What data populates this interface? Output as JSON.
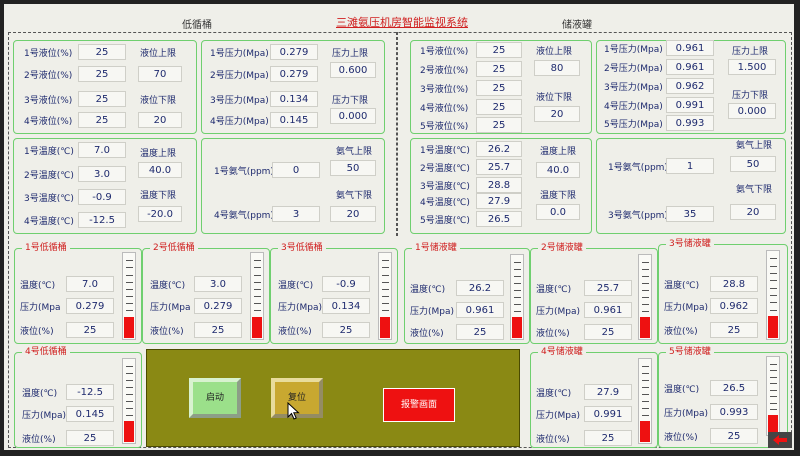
{
  "title": "三滩氨压机房智能监视系统",
  "headers": {
    "left": "低循桶",
    "right": "储液罐"
  },
  "lt_levels": {
    "rows": [
      {
        "label": "1号液位(%)",
        "value": "25"
      },
      {
        "label": "2号液位(%)",
        "value": "25"
      },
      {
        "label": "3号液位(%)",
        "value": "25"
      },
      {
        "label": "4号液位(%)",
        "value": "25"
      }
    ],
    "limits": [
      {
        "label": "液位上限",
        "value": "70"
      },
      {
        "label": "液位下限",
        "value": "20"
      }
    ]
  },
  "lt_press": {
    "rows": [
      {
        "label": "1号压力(Mpa)",
        "value": "0.279"
      },
      {
        "label": "2号压力(Mpa)",
        "value": "0.279"
      },
      {
        "label": "3号压力(Mpa)",
        "value": "0.134"
      },
      {
        "label": "4号压力(Mpa)",
        "value": "0.145"
      }
    ],
    "limits": [
      {
        "label": "压力上限",
        "value": "0.600"
      },
      {
        "label": "压力下限",
        "value": "0.000"
      }
    ]
  },
  "lt_temp": {
    "rows": [
      {
        "label": "1号温度(℃)",
        "value": "7.0"
      },
      {
        "label": "2号温度(℃)",
        "value": "3.0"
      },
      {
        "label": "3号温度(℃)",
        "value": "-0.9"
      },
      {
        "label": "4号温度(℃)",
        "value": "-12.5"
      }
    ],
    "limits": [
      {
        "label": "温度上限",
        "value": "40.0"
      },
      {
        "label": "温度下限",
        "value": "-20.0"
      }
    ]
  },
  "lt_ammonia": {
    "rows": [
      {
        "label": "1号氨气(ppm)",
        "value": "0"
      },
      {
        "label": "4号氨气(ppm)",
        "value": "3"
      }
    ],
    "limits": [
      {
        "label": "氨气上限",
        "value": "50"
      },
      {
        "label": "氨气下限",
        "value": "20"
      }
    ]
  },
  "rt_levels": {
    "rows": [
      {
        "label": "1号液位(%)",
        "value": "25"
      },
      {
        "label": "2号液位(%)",
        "value": "25"
      },
      {
        "label": "3号液位(%)",
        "value": "25"
      },
      {
        "label": "4号液位(%)",
        "value": "25"
      },
      {
        "label": "5号液位(%)",
        "value": "25"
      }
    ],
    "limits": [
      {
        "label": "液位上限",
        "value": "80"
      },
      {
        "label": "液位下限",
        "value": "20"
      }
    ]
  },
  "rt_press": {
    "rows": [
      {
        "label": "1号压力(Mpa)",
        "value": "0.961"
      },
      {
        "label": "2号压力(Mpa)",
        "value": "0.961"
      },
      {
        "label": "3号压力(Mpa)",
        "value": "0.962"
      },
      {
        "label": "4号压力(Mpa)",
        "value": "0.991"
      },
      {
        "label": "5号压力(Mpa)",
        "value": "0.993"
      }
    ],
    "limits": [
      {
        "label": "压力上限",
        "value": "1.500"
      },
      {
        "label": "压力下限",
        "value": "0.000"
      }
    ]
  },
  "rt_temp": {
    "rows": [
      {
        "label": "1号温度(℃)",
        "value": "26.2"
      },
      {
        "label": "2号温度(℃)",
        "value": "25.7"
      },
      {
        "label": "3号温度(℃)",
        "value": "28.8"
      },
      {
        "label": "4号温度(℃)",
        "value": "27.9"
      },
      {
        "label": "5号温度(℃)",
        "value": "26.5"
      }
    ],
    "limits": [
      {
        "label": "温度上限",
        "value": "40.0"
      },
      {
        "label": "温度下限",
        "value": "0.0"
      }
    ]
  },
  "rt_ammonia": {
    "rows": [
      {
        "label": "1号氨气(ppm)",
        "value": "1"
      },
      {
        "label": "3号氨气(ppm)",
        "value": "35"
      }
    ],
    "limits": [
      {
        "label": "氨气上限",
        "value": "50"
      },
      {
        "label": "氨气下限",
        "value": "20"
      }
    ]
  },
  "units": [
    {
      "title": "1号低循桶",
      "temp_label": "温度(℃)",
      "temp": "7.0",
      "press_label": "压力(Mpa",
      "press": "0.279",
      "level_label": "液位(%)",
      "level": "25"
    },
    {
      "title": "2号低循桶",
      "temp_label": "温度(℃)",
      "temp": "3.0",
      "press_label": "压力(Mpa",
      "press": "0.279",
      "level_label": "液位(%)",
      "level": "25"
    },
    {
      "title": "3号低循桶",
      "temp_label": "温度(℃)",
      "temp": "-0.9",
      "press_label": "压力(Mpa)",
      "press": "0.134",
      "level_label": "液位(%)",
      "level": "25"
    },
    {
      "title": "1号储液罐",
      "temp_label": "温度(℃)",
      "temp": "26.2",
      "press_label": "压力(Mpa)",
      "press": "0.961",
      "level_label": "液位(%)",
      "level": "25"
    },
    {
      "title": "2号储液罐",
      "temp_label": "温度(℃)",
      "temp": "25.7",
      "press_label": "压力(Mpa)",
      "press": "0.961",
      "level_label": "液位(%)",
      "level": "25"
    },
    {
      "title": "3号储液罐",
      "temp_label": "温度(℃)",
      "temp": "28.8",
      "press_label": "压力(Mpa)",
      "press": "0.962",
      "level_label": "液位(%)",
      "level": "25"
    },
    {
      "title": "4号低循桶",
      "temp_label": "温度(℃)",
      "temp": "-12.5",
      "press_label": "压力(Mpa)",
      "press": "0.145",
      "level_label": "液位(%)",
      "level": "25"
    },
    {
      "title": "4号储液罐",
      "temp_label": "温度(℃)",
      "temp": "27.9",
      "press_label": "压力(Mpa)",
      "press": "0.991",
      "level_label": "液位(%)",
      "level": "25"
    },
    {
      "title": "5号储液罐",
      "temp_label": "温度(℃)",
      "temp": "26.5",
      "press_label": "压力(Mpa)",
      "press": "0.993",
      "level_label": "液位(%)",
      "level": "25"
    }
  ],
  "controls": {
    "start": "启动",
    "reset": "复位",
    "alarm": "报警画面"
  },
  "level_fill_percent": 25,
  "icons": {
    "cursor": "mouse-pointer-icon",
    "back": "back-arrow-icon"
  },
  "colors": {
    "accent": "#6fcf6f",
    "alarm": "#e11111",
    "panel": "#8a8914",
    "title": "#d02020"
  }
}
